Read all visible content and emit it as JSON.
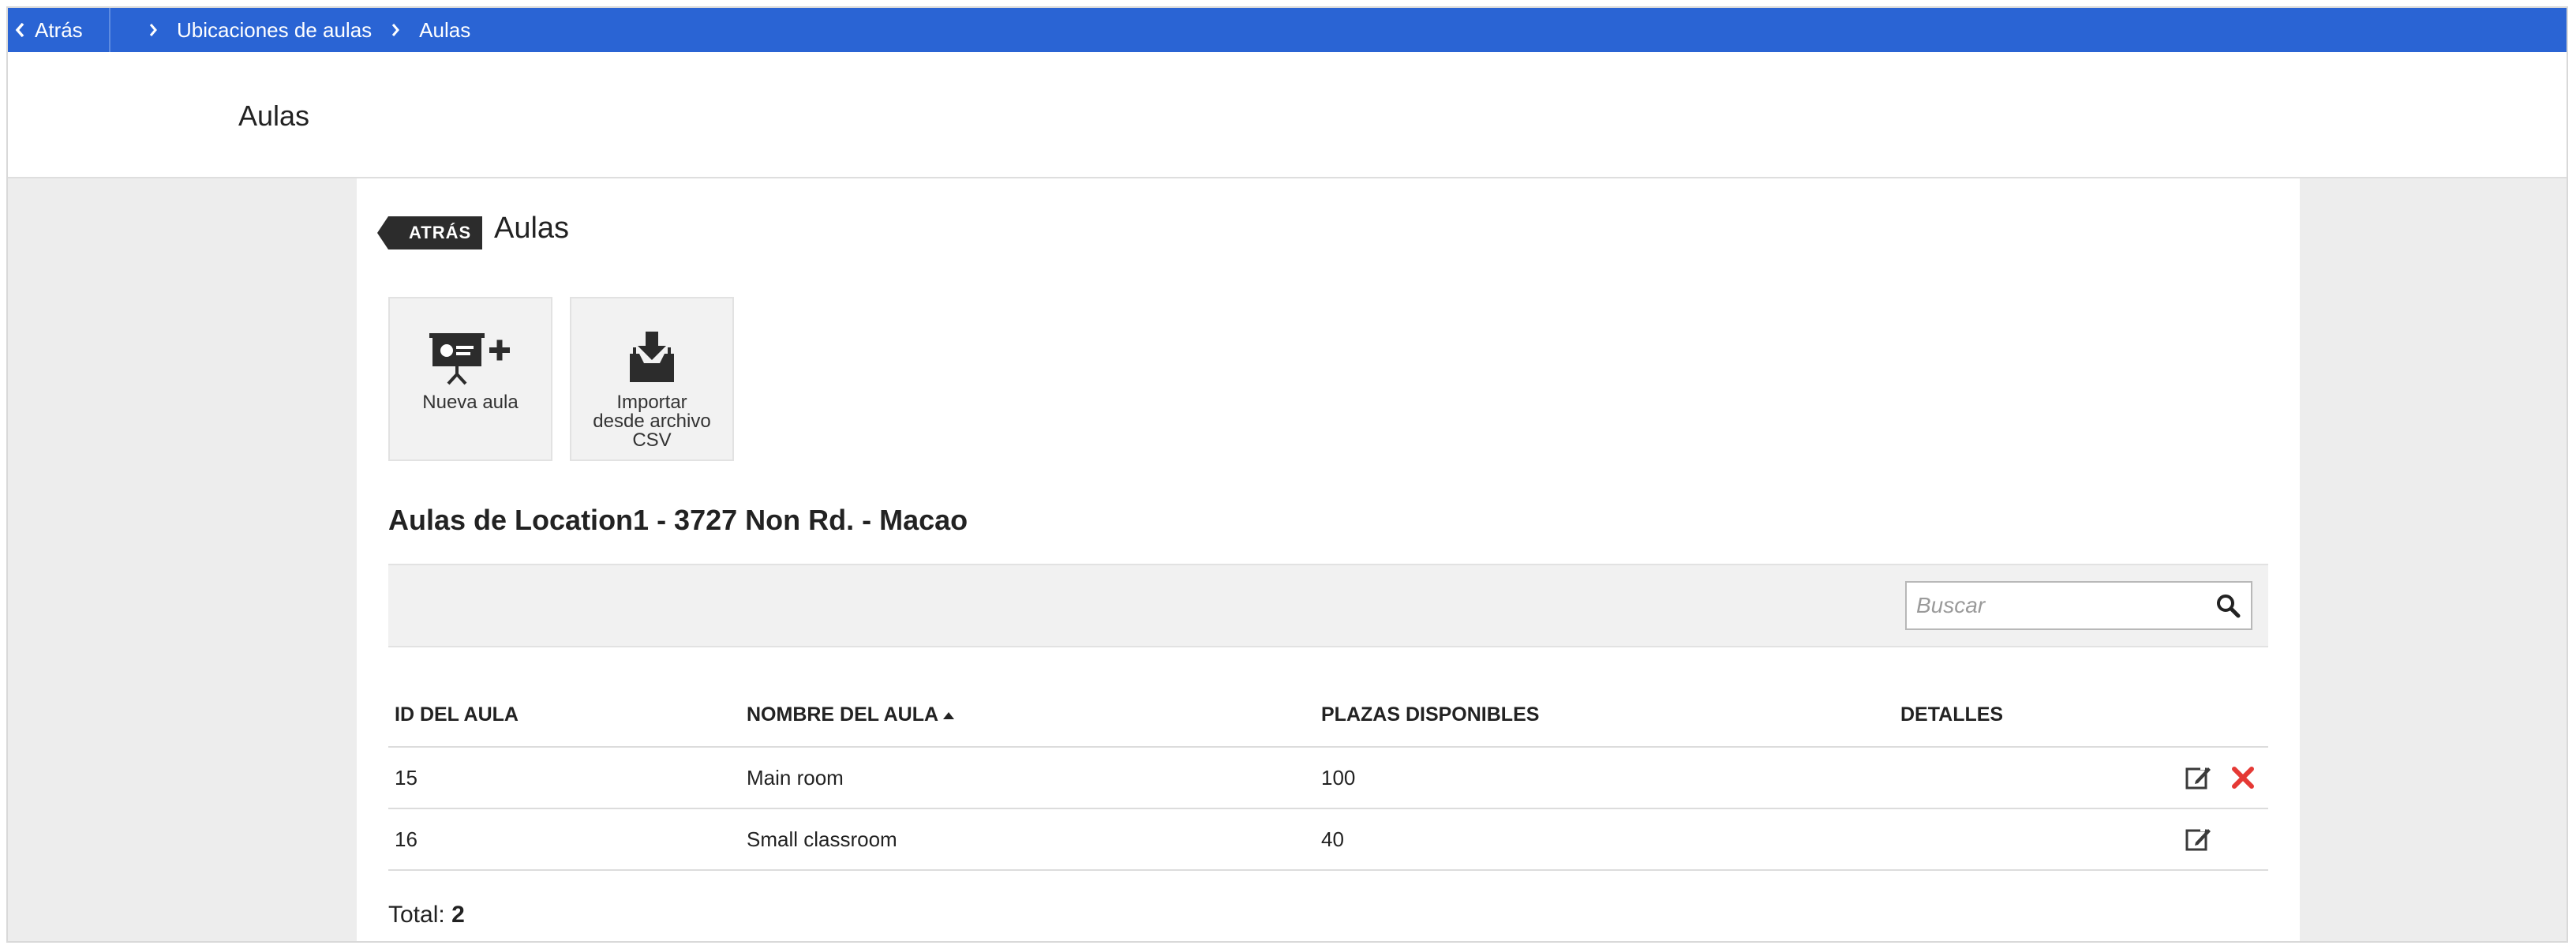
{
  "topbar": {
    "back_label": "Atrás",
    "breadcrumbs": [
      "Ubicaciones de aulas",
      "Aulas"
    ]
  },
  "header": {
    "title": "Aulas"
  },
  "panel": {
    "back_tag": "ATRÁS",
    "title": "Aulas",
    "actions": [
      {
        "label": "Nueva aula",
        "icon": "new-classroom-icon"
      },
      {
        "label": "Importar desde archivo CSV",
        "icon": "import-csv-icon"
      }
    ],
    "section_title": "Aulas de Location1 - 3727 Non Rd. - Macao"
  },
  "search": {
    "placeholder": "Buscar",
    "value": ""
  },
  "table": {
    "headers": [
      "ID DEL AULA",
      "NOMBRE DEL AULA",
      "PLAZAS DISPONIBLES",
      "DETALLES"
    ],
    "sorted_column": "NOMBRE DEL AULA",
    "sort_direction": "ascending",
    "rows": [
      {
        "id": "15",
        "name": "Main room",
        "plazas": "100",
        "editable": true,
        "deletable": true
      },
      {
        "id": "16",
        "name": "Small classroom",
        "plazas": "40",
        "editable": true,
        "deletable": false
      }
    ]
  },
  "total": {
    "label": "Total:",
    "value": "2"
  },
  "colors": {
    "topbar": "#2a64d4",
    "delete": "#e53935",
    "text": "#222222",
    "page_bg": "#ededed"
  }
}
